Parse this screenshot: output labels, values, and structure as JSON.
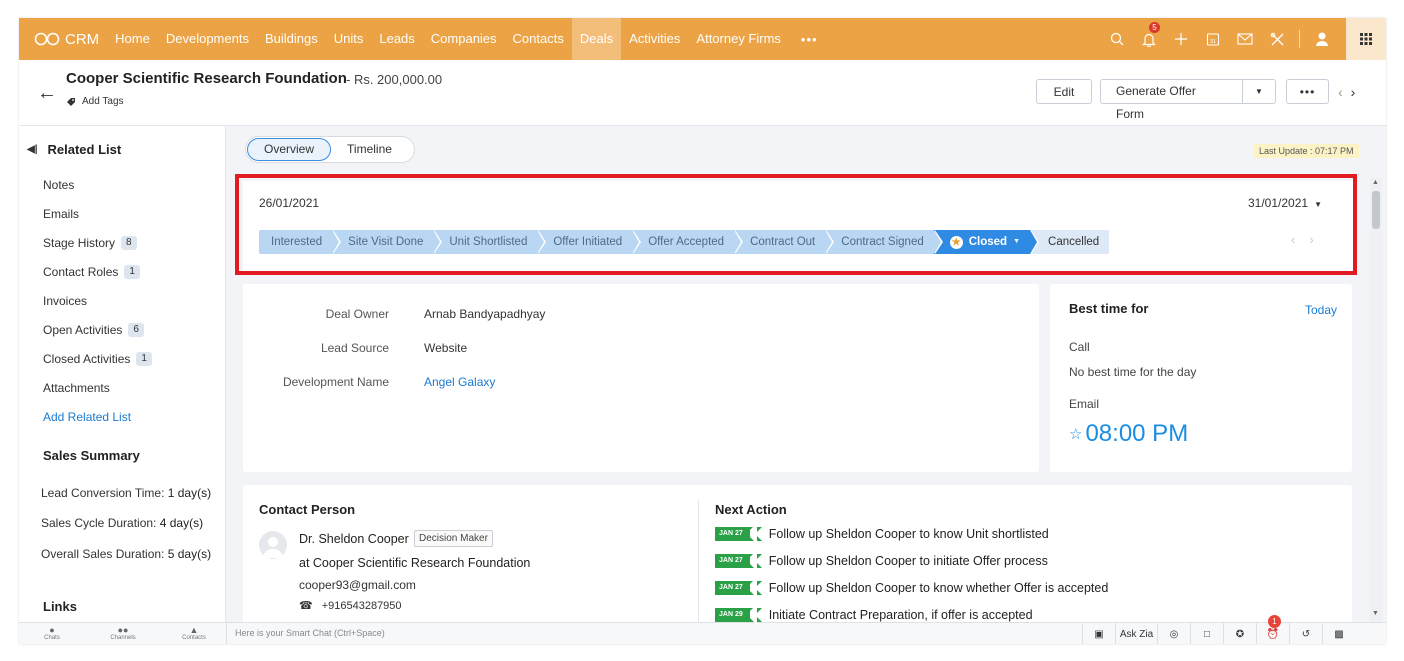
{
  "nav": {
    "brand": "CRM",
    "items": [
      "Home",
      "Developments",
      "Buildings",
      "Units",
      "Leads",
      "Companies",
      "Contacts",
      "Deals",
      "Activities",
      "Attorney Firms"
    ],
    "active": "Deals",
    "more": "•••",
    "notification_count": "5",
    "accent": "#eba345"
  },
  "record": {
    "title": "Cooper Scientific Research Foundation",
    "amount": "- Rs. 200,000.00",
    "add_tags": "Add Tags",
    "edit_label": "Edit",
    "generate_label": "Generate Offer Form",
    "more_label": "•••"
  },
  "sidebar": {
    "heading": "Related List",
    "items": [
      {
        "label": "Notes",
        "count": ""
      },
      {
        "label": "Emails",
        "count": ""
      },
      {
        "label": "Stage History",
        "count": "8"
      },
      {
        "label": "Contact Roles",
        "count": "1"
      },
      {
        "label": "Invoices",
        "count": ""
      },
      {
        "label": "Open Activities",
        "count": "6"
      },
      {
        "label": "Closed Activities",
        "count": "1"
      },
      {
        "label": "Attachments",
        "count": ""
      }
    ],
    "add_related": "Add Related List",
    "summary_title": "Sales Summary",
    "summary": [
      {
        "label": "Lead Conversion Time:",
        "value": "1 day(s)"
      },
      {
        "label": "Sales Cycle Duration:",
        "value": "4 day(s)"
      },
      {
        "label": "Overall Sales Duration:",
        "value": "5 day(s)"
      }
    ],
    "links_title": "Links"
  },
  "tabs": [
    "Overview",
    "Timeline"
  ],
  "last_update": "Last Update : 07:17 PM",
  "stage_bar": {
    "start_date": "26/01/2021",
    "end_date": "31/01/2021",
    "stages": [
      "Interested",
      "Site Visit Done",
      "Unit Shortlisted",
      "Offer Initiated",
      "Offer Accepted",
      "Contract Out",
      "Contract Signed"
    ],
    "current": "Closed",
    "after": "Cancelled",
    "current_color": "#2f8ae4",
    "highlight_color": "#e21b23"
  },
  "details": [
    {
      "key": "Deal Owner",
      "value": "Arnab Bandyapadhyay"
    },
    {
      "key": "Lead Source",
      "value": "Website"
    },
    {
      "key": "Development Name",
      "value": "Angel Galaxy"
    }
  ],
  "best_time": {
    "title": "Best time for",
    "today": "Today",
    "call_label": "Call",
    "call_value": "No best time for the day",
    "email_label": "Email",
    "email_value": "08:00 PM"
  },
  "contact": {
    "title": "Contact Person",
    "name": "Dr. Sheldon Cooper",
    "role": "Decision Maker",
    "org": "at Cooper Scientific Research Foundation",
    "email": "cooper93@gmail.com",
    "phone": "+916543287950"
  },
  "next_action": {
    "title": "Next Action",
    "items": [
      {
        "date": "JAN 27",
        "text": "Follow up Sheldon Cooper to know Unit shortlisted"
      },
      {
        "date": "JAN 27",
        "text": "Follow up Sheldon Cooper to initiate Offer process"
      },
      {
        "date": "JAN 27",
        "text": "Follow up Sheldon Cooper to know whether Offer is accepted"
      },
      {
        "date": "JAN 29",
        "text": "Initiate Contract Preparation, if offer is accepted"
      }
    ]
  },
  "bottom": {
    "tabs": [
      "Chats",
      "Channels",
      "Contacts"
    ],
    "smartchat": "Here is your Smart Chat (Ctrl+Space)",
    "ask_zia": "Ask Zia",
    "alarm_count": "1"
  }
}
